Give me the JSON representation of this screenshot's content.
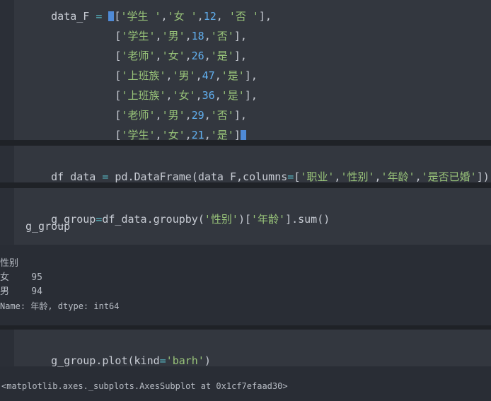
{
  "cell1": {
    "lines": [
      {
        "prefix": "data_F ",
        "op": "=",
        "rest_a": " ",
        "bracket": "[",
        "content": "[ '学生 ', '女 ',12, '否 '],"
      },
      {
        "indent": "          ",
        "content": "['学生','男',18,'否'],"
      },
      {
        "indent": "          ",
        "content": "['老师','女',26,'是'],"
      },
      {
        "indent": "          ",
        "content": "['上班族','男',47,'是'],"
      },
      {
        "indent": "          ",
        "content": "['上班族','女',36,'是'],"
      },
      {
        "indent": "          ",
        "content": "['老师','男',29,'否'],"
      },
      {
        "indent": "          ",
        "content": "['学生','女',21,'是']]"
      }
    ]
  },
  "cell2": {
    "code": "df_data = pd.DataFrame(data_F,columns=['职业','性别','年龄','是否已婚'])"
  },
  "cell3": {
    "code_line1": "g_group=df_data.groupby('性别')['年龄'].sum()",
    "code_line2": "g_group"
  },
  "output3": {
    "lines": [
      "性别",
      "女    95",
      "男    94",
      "Name: 年龄, dtype: int64"
    ]
  },
  "cell4": {
    "code": "g_group.plot(kind='barh')"
  },
  "output4": {
    "text": "<matplotlib.axes._subplots.AxesSubplot at 0x1cf7efaad30>"
  },
  "colors": {
    "string": "#98c379",
    "number": "#61afef",
    "operator": "#56b6c2",
    "background": "#292d35",
    "cell": "#33373f"
  }
}
